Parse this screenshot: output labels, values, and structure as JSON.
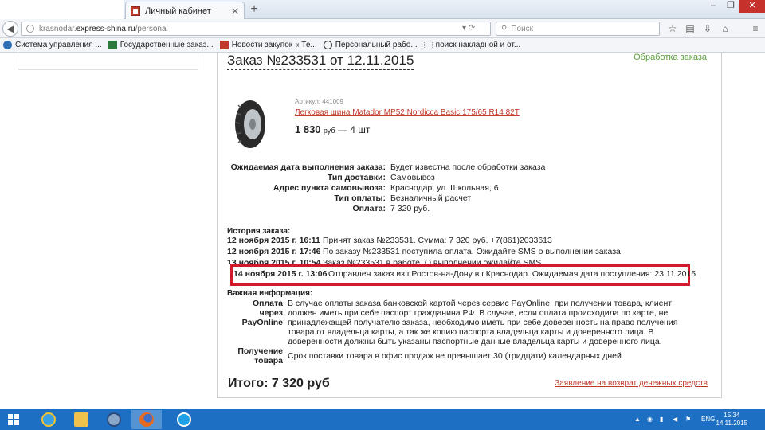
{
  "browser": {
    "tab_title": "Личный кабинет",
    "tab_close": "✕",
    "new_tab": "+",
    "url_domain_prefix": "krasnodar.",
    "url_domain": "express-shina.ru",
    "url_path": "/personal",
    "search_placeholder": "Поиск",
    "window_controls": [
      "–",
      "❐",
      "✕"
    ]
  },
  "bookmarks": [
    {
      "label": "Система управления ...",
      "color": "#2f6fb5"
    },
    {
      "label": "Государственные заказ...",
      "color": "#2d7a3d"
    },
    {
      "label": "Новости закупок « Те...",
      "color": "#c0392b"
    },
    {
      "label": "Персональный рабо...",
      "color": "#333333"
    },
    {
      "label": "поиск накладной и от...",
      "color": "#999999"
    }
  ],
  "order": {
    "title": "Заказ №233531 от 12.11.2015",
    "status": "Обработка заказа",
    "product": {
      "article": "Артикул: 441009",
      "name": "Легковая шина Matador MP52 Nordicca Basic 175/65 R14 82T",
      "price": "1 830",
      "currency": "руб",
      "qty": "— 4 шт"
    },
    "details": [
      {
        "label": "Ожидаемая дата выполнения заказа:",
        "value": "Будет известна после обработки заказа"
      },
      {
        "label": "Тип доставки:",
        "value": "Самовывоз"
      },
      {
        "label": "Адрес пункта самовывоза:",
        "value": "Краснодар, ул. Школьная, 6"
      },
      {
        "label": "Тип оплаты:",
        "value": "Безналичный расчет"
      },
      {
        "label": "Оплата:",
        "value": "7 320 руб."
      }
    ],
    "history_title": "История заказа:",
    "history": [
      {
        "date": "12 ноября 2015 г. 16:11",
        "text": "Принят заказ №233531. Сумма: 7 320 руб. +7(861)2033613"
      },
      {
        "date": "12 ноября 2015 г. 17:46",
        "text": "По заказу №233531 поступила оплата. Ожидайте SMS о выполнении заказа"
      },
      {
        "date": "13 ноября 2015 г. 10:54",
        "text": "Заказ №233531 в работе. О выполнении ожидайте SMS"
      }
    ],
    "highlighted_event": {
      "date": "14 ноября 2015 г. 13:06",
      "text": "Отправлен заказ из г.Ростов-на-Дону в г.Краснодар. Ожидаемая дата поступления: 23.11.2015"
    },
    "important_title": "Важная информация:",
    "important": [
      {
        "label": "Оплата через PayOnline",
        "text": "В случае оплаты заказа банковской картой через сервис PayOnline, при получении товара, клиент должен иметь при себе паспорт гражданина РФ. В случае, если оплата происходила по карте, не принадлежащей получателю заказа, необходимо иметь при себе доверенность на право получения товара от владельца карты, а так же копию паспорта владельца карты и доверенного лица. В доверенности должны быть указаны паспортные данные владельца карты и доверенного лица."
      },
      {
        "label": "Получение товара",
        "text": "Срок поставки товара в офис продаж не превышает 30 (тридцати) календарных дней."
      }
    ],
    "total": "Итого: 7 320 руб",
    "refund_link": "Заявление на возврат денежных средств"
  },
  "taskbar": {
    "lang": "ENG",
    "time": "15:34",
    "date": "14.11.2015"
  }
}
